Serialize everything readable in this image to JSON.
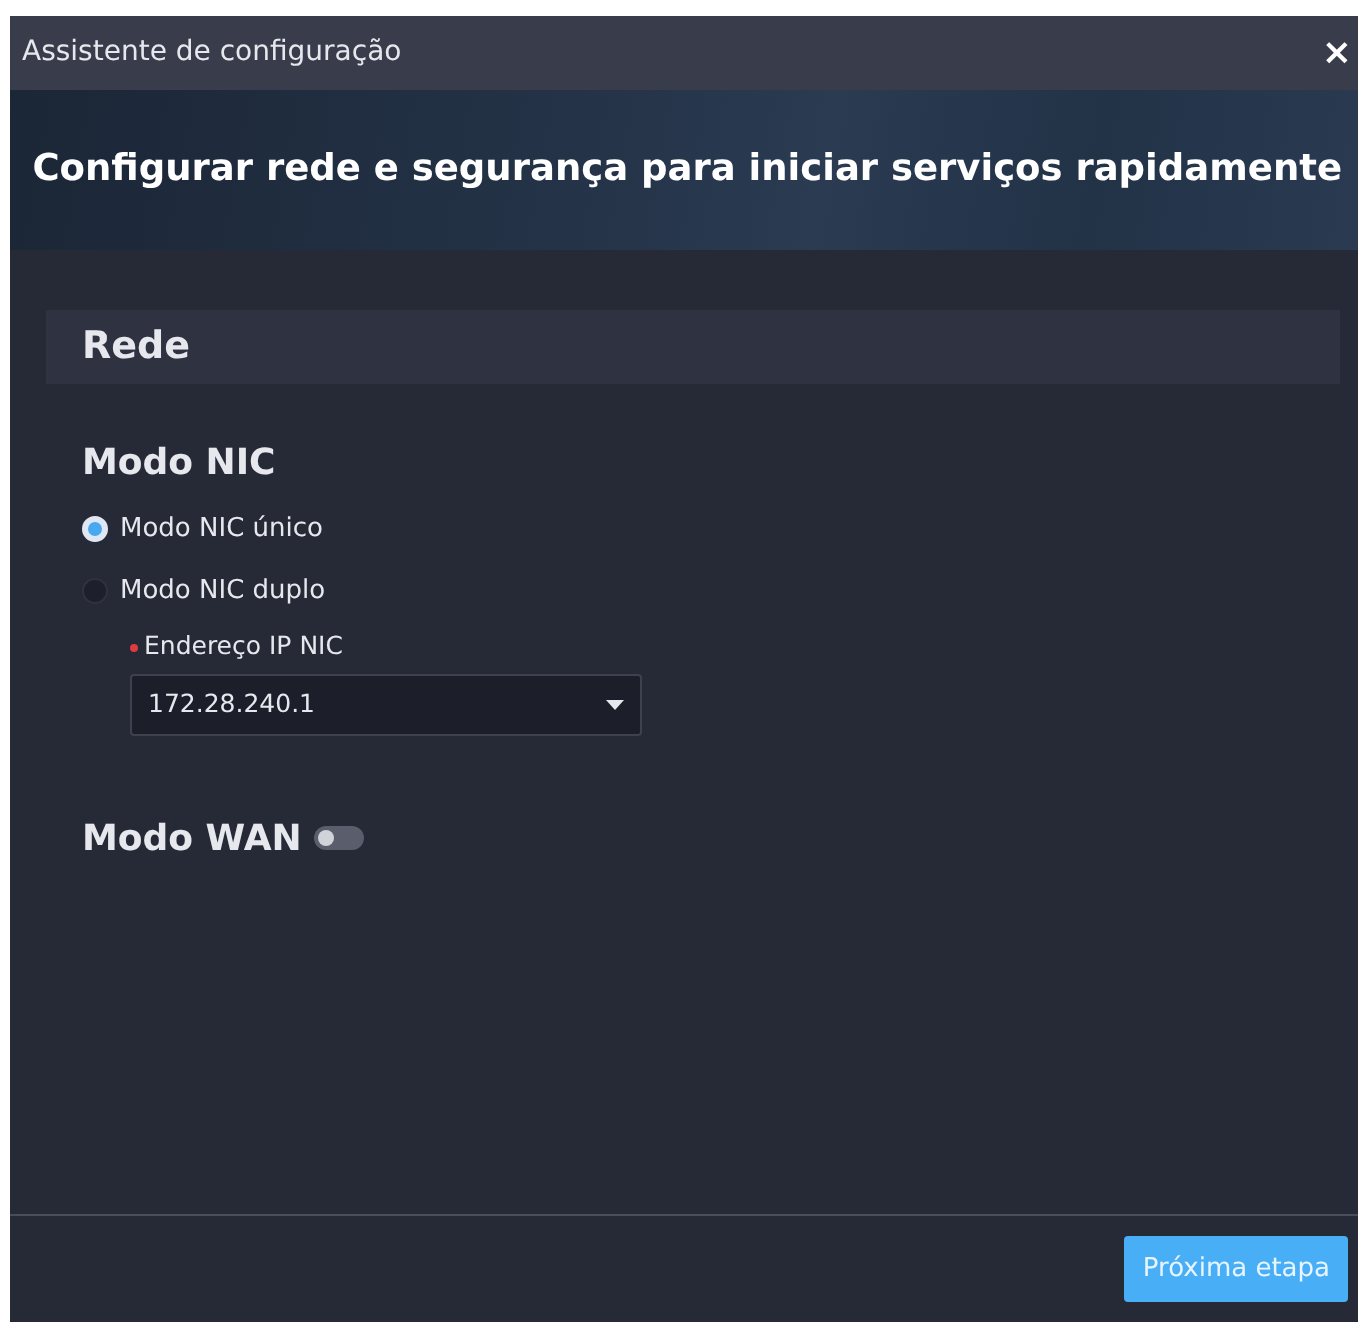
{
  "window": {
    "title": "Assistente de configuração",
    "close": "×"
  },
  "banner": {
    "title": "Configurar rede e segurança para iniciar serviços rapidamente"
  },
  "section": {
    "title": "Rede"
  },
  "nic_mode": {
    "title": "Modo NIC",
    "options": [
      {
        "label": "Modo NIC único",
        "selected": true
      },
      {
        "label": "Modo NIC duplo",
        "selected": false
      }
    ],
    "field": {
      "label": "Endereço IP NIC",
      "required": true,
      "value": "172.28.240.1"
    }
  },
  "wan_mode": {
    "title": "Modo WAN",
    "on": false
  },
  "footer": {
    "button": "Próxima etapa"
  }
}
